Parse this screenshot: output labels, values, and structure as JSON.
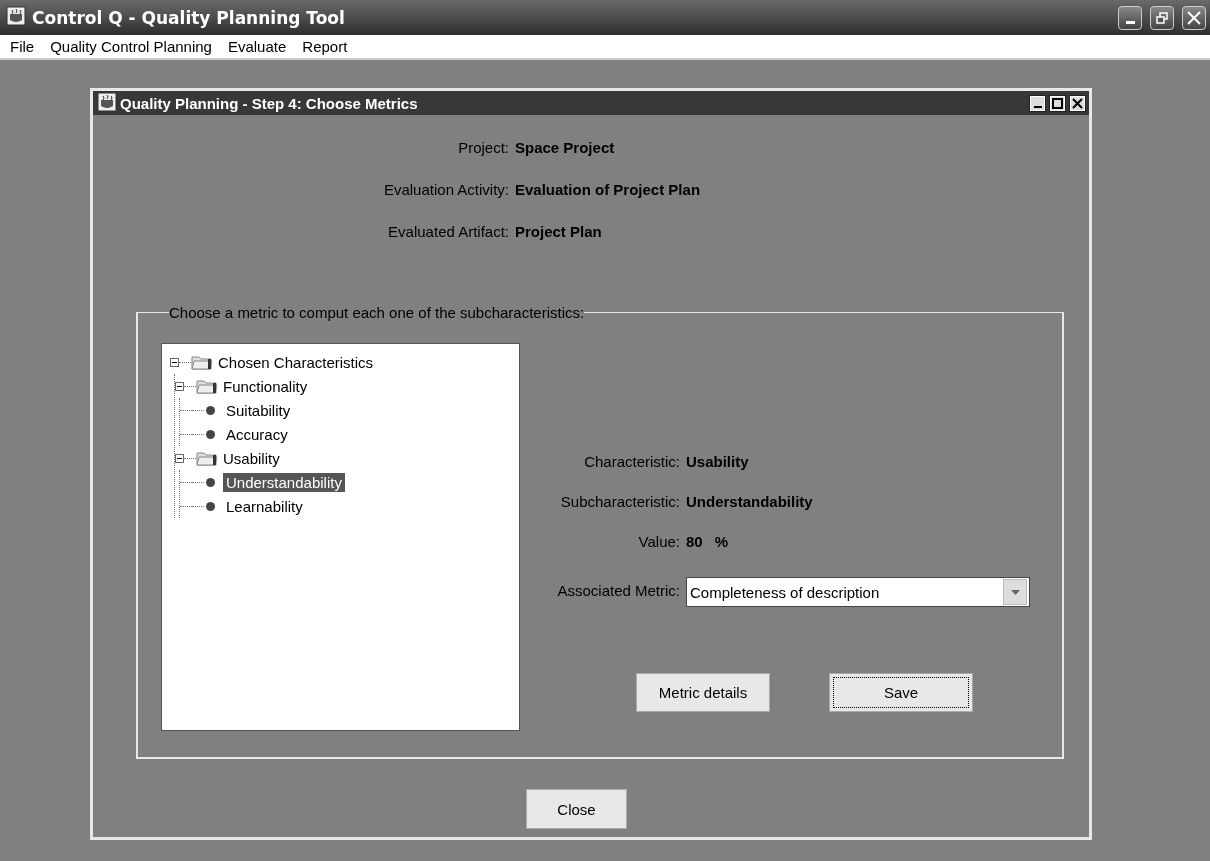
{
  "window": {
    "title": "Control Q - Quality Planning Tool"
  },
  "menu": [
    {
      "label": "File"
    },
    {
      "label": "Quality Control Planning"
    },
    {
      "label": "Evaluate"
    },
    {
      "label": "Report"
    }
  ],
  "dialog": {
    "title": "Quality Planning - Step 4: Choose Metrics",
    "info": [
      {
        "label": "Project:",
        "value": "Space Project"
      },
      {
        "label": "Evaluation Activity:",
        "value": "Evaluation of Project Plan"
      },
      {
        "label": "Evaluated Artifact:",
        "value": "Project Plan"
      }
    ],
    "group_title": "Choose a metric to comput each one of the subcharacteristics:",
    "tree": [
      {
        "label": "Chosen Characteristics",
        "kind": "folder",
        "expanded": true,
        "selected": false,
        "children": [
          {
            "label": "Functionality",
            "kind": "folder",
            "expanded": true,
            "selected": false,
            "children": [
              {
                "label": "Suitability",
                "kind": "leaf",
                "selected": false
              },
              {
                "label": "Accuracy",
                "kind": "leaf",
                "selected": false
              }
            ]
          },
          {
            "label": "Usability",
            "kind": "folder",
            "expanded": true,
            "selected": false,
            "children": [
              {
                "label": "Understandability",
                "kind": "leaf",
                "selected": true
              },
              {
                "label": "Learnability",
                "kind": "leaf",
                "selected": false
              }
            ]
          }
        ]
      }
    ],
    "details": [
      {
        "label": "Characteristic:",
        "value": "Usability"
      },
      {
        "label": "Subcharacteristic:",
        "value": "Understandability"
      },
      {
        "label": "Value:",
        "value": "80",
        "unit": "%"
      }
    ],
    "metric": {
      "label": "Associated Metric:",
      "value": "Completeness of description"
    },
    "buttons": [
      {
        "label": "Metric details",
        "focused": false
      },
      {
        "label": "Save",
        "focused": true
      }
    ],
    "close_button": "Close"
  }
}
